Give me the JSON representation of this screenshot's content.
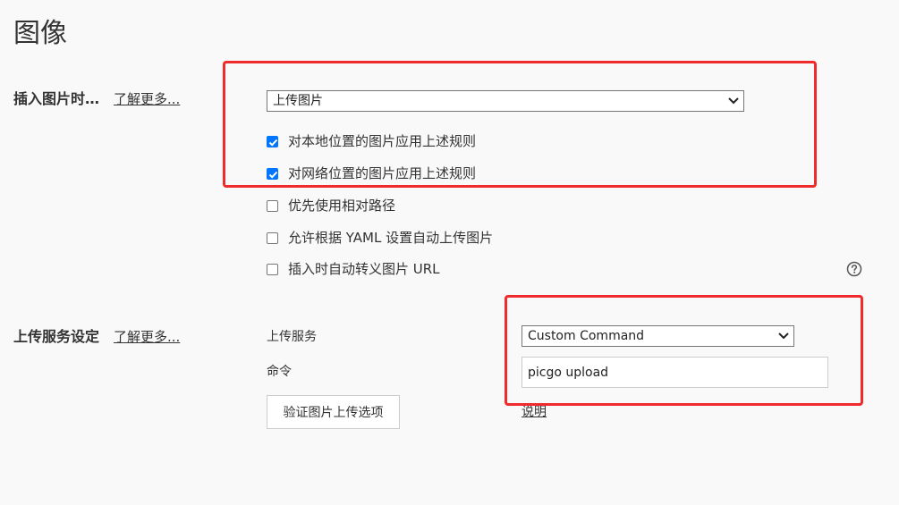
{
  "page": {
    "title": "图像"
  },
  "insert_image": {
    "label": "插入图片时…",
    "learn_more": "了解更多...",
    "action_select": {
      "selected": "上传图片",
      "chevron_icon": "chevron-down-icon"
    },
    "options": [
      {
        "label": "对本地位置的图片应用上述规则",
        "checked": true
      },
      {
        "label": "对网络位置的图片应用上述规则",
        "checked": true
      },
      {
        "label": "优先使用相对路径",
        "checked": false
      },
      {
        "label": "允许根据 YAML 设置自动上传图片",
        "checked": false
      },
      {
        "label": "插入时自动转义图片 URL",
        "checked": false
      }
    ],
    "help_icon": "question-circle-icon"
  },
  "upload_service": {
    "label": "上传服务设定",
    "learn_more": "了解更多...",
    "service_label": "上传服务",
    "service_select": {
      "selected": "Custom Command",
      "chevron_icon": "chevron-down-icon"
    },
    "command_label": "命令",
    "command_value": "picgo upload",
    "verify_button": "验证图片上传选项",
    "explain_link": "说明"
  },
  "colors": {
    "background": "#f9f9f9",
    "checkbox_checked": "#0075ff",
    "highlight_annotation": "#ef2b2b",
    "text": "#333333"
  }
}
